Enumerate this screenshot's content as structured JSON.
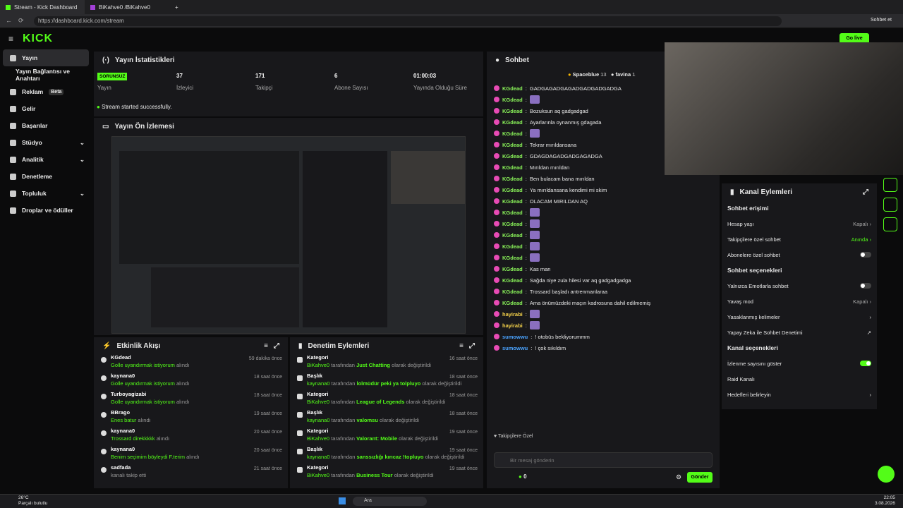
{
  "browser": {
    "tab1": "Stream - Kick Dashboard",
    "tab2": "BiKahve0 /BiKahve0",
    "url": "https://dashboard.kick.com/stream",
    "profile": "Sohbet et"
  },
  "header": {
    "logo": "KICK",
    "go_live": "Go live"
  },
  "sidebar": {
    "items": [
      {
        "label": "Yayın"
      },
      {
        "label": "Yayın Bağlantısı ve Anahtarı"
      },
      {
        "label": "Reklam",
        "badge": "Beta"
      },
      {
        "label": "Gelir"
      },
      {
        "label": "Başarılar"
      },
      {
        "label": "Stüdyo"
      },
      {
        "label": "Analitik"
      },
      {
        "label": "Denetleme"
      },
      {
        "label": "Topluluk"
      },
      {
        "label": "Droplar ve ödüller"
      }
    ]
  },
  "stats": {
    "title": "Yayın İstatistikleri",
    "status_badge": "SORUNSUZ",
    "status_label": "Yayın",
    "viewers": "37",
    "viewers_l": "İzleyici",
    "followers": "171",
    "followers_l": "Takipçi",
    "subs": "6",
    "subs_l": "Abone Sayısı",
    "time": "01:00:03",
    "time_l": "Yayında Olduğu Süre",
    "success": "Stream started successfully."
  },
  "preview": {
    "title": "Yayın Ön İzlemesi"
  },
  "activity": {
    "title": "Etkinlik Akışı",
    "rows": [
      {
        "t": "KGdead",
        "s": "Golle uyandırmak istiyorum",
        "sx": " alındı",
        "time": "59 dakika önce"
      },
      {
        "t": "kaynana0",
        "s": "Golle uyandırmak istiyorum",
        "sx": " alındı",
        "time": "18 saat önce"
      },
      {
        "t": "Turboyagizabi",
        "s": "Golle uyandırmak istiyorum",
        "sx": " alındı",
        "time": "18 saat önce"
      },
      {
        "t": "BBrago",
        "s": "Enes batur",
        "sx": " alındı",
        "time": "19 saat önce"
      },
      {
        "t": "kaynana0",
        "s": "Trossard direkkkkk",
        "sx": " alındı",
        "time": "20 saat önce"
      },
      {
        "t": "kaynana0",
        "s": "Benim seçimim böyleydi F.terim",
        "sx": " alındı",
        "time": "20 saat önce"
      },
      {
        "t": "sadfada",
        "s": "",
        "sx": "kanalı takip etti",
        "time": "21 saat önce"
      }
    ]
  },
  "mod": {
    "title": "Denetim Eylemleri",
    "rows": [
      {
        "t": "Kategori",
        "u": "BiKahve0",
        "m": " tarafından ",
        "v": "Just Chatting",
        "e": " olarak değiştirildi",
        "time": "16 saat önce"
      },
      {
        "t": "Başlık",
        "u": "kaynana0",
        "m": " tarafından ",
        "v": "lolmüdür peki ya tolpluyo",
        "e": " olarak değiştirildi",
        "time": "18 saat önce"
      },
      {
        "t": "Kategori",
        "u": "BiKahve0",
        "m": " tarafından ",
        "v": "League of Legends",
        "e": " olarak değiştirildi",
        "time": "18 saat önce"
      },
      {
        "t": "Başlık",
        "u": "kaynana0",
        "m": " tarafından ",
        "v": "valomsu",
        "e": " olarak değiştirildi",
        "time": "18 saat önce"
      },
      {
        "t": "Kategori",
        "u": "BiKahve0",
        "m": " tarafından ",
        "v": "Valorant: Mobile",
        "e": " olarak değiştirildi",
        "time": "19 saat önce"
      },
      {
        "t": "Başlık",
        "u": "kaynana0",
        "m": " tarafından ",
        "v": "sanssızlığı kırıcaz !topluyo",
        "e": " olarak değiştirildi",
        "time": "19 saat önce"
      },
      {
        "t": "Kategori",
        "u": "BiKahve0",
        "m": " tarafından ",
        "v": "Business Tour",
        "e": " olarak değiştirildi",
        "time": "19 saat önce"
      }
    ]
  },
  "chat": {
    "title": "Sohbet",
    "top1": "Spaceblue",
    "top1n": "13",
    "top2": "favina",
    "top2n": "1",
    "messages": [
      {
        "n": "KGdead",
        "m": "GADGAGADGAGADGADGADGADGA"
      },
      {
        "n": "KGdead",
        "m": ""
      },
      {
        "n": "KGdead",
        "m": "Bozuksun aq gadgadgad"
      },
      {
        "n": "KGdead",
        "m": "Ayarlarınla oynanmış gdagada"
      },
      {
        "n": "KGdead",
        "m": ""
      },
      {
        "n": "KGdead",
        "m": "Tekrar mırıldansana"
      },
      {
        "n": "KGdead",
        "m": "GDAGDAGADGADGAGADGA"
      },
      {
        "n": "KGdead",
        "m": "Mırıldan mırıldan"
      },
      {
        "n": "KGdead",
        "m": "Ben bulacam bana mırıldan"
      },
      {
        "n": "KGdead",
        "m": "Ya mırıldansana kendimi mi skim"
      },
      {
        "n": "KGdead",
        "m": "OLACAM MIRILDAN AQ"
      },
      {
        "n": "KGdead",
        "m": ""
      },
      {
        "n": "KGdead",
        "m": ""
      },
      {
        "n": "KGdead",
        "m": ""
      },
      {
        "n": "KGdead",
        "m": ""
      },
      {
        "n": "KGdead",
        "m": ""
      },
      {
        "n": "KGdead",
        "m": "Kas man"
      },
      {
        "n": "KGdead",
        "m": "Sağda niye zula hilesi var aq gadgadgadga"
      },
      {
        "n": "KGdead",
        "m": "Trossard başladı antrenmanlarаа"
      },
      {
        "n": "KGdead",
        "m": "Ama önümüzdeki maçın kadrosuna dahil edilmemiş"
      },
      {
        "n": "hayirabi",
        "m": ""
      },
      {
        "n": "hayirabi",
        "m": ""
      },
      {
        "n": "sumowwu",
        "m": "! otobüs bekliyorummm"
      },
      {
        "n": "sumowwu",
        "m": "! çok sıkıldım"
      }
    ],
    "follower_only": "Takipçilere Özel",
    "placeholder": "Bir mesaj gönderin",
    "send": "Gönder",
    "count": "0"
  },
  "actions": {
    "title": "Kanal Eylemleri",
    "access": "Sohbet erişimi",
    "account_age": "Hesap yaşı",
    "account_age_v": "Kapalı",
    "follower_chat": "Takipçilere özel sohbet",
    "follower_chat_v": "Anında",
    "sub_chat": "Abonelere özel sohbet",
    "options": "Sohbet seçenekleri",
    "emote": "Yalnızca Emotlarla sohbet",
    "slow": "Yavaş mod",
    "slow_v": "Kapalı",
    "banned": "Yasaklanmış kelimeler",
    "ai": "Yapay Zeka ile Sohbet Denetimi",
    "channel": "Kanal seçenekleri",
    "viewcount": "İzlenme sayısını göster",
    "raid": "Raid Kanalı",
    "goals": "Hedefleri belirleyin"
  },
  "taskbar": {
    "weather": "26°C",
    "weather2": "Parçalı bulutlu",
    "search": "Ara",
    "time": "22:05",
    "date": "3.08.2026"
  }
}
